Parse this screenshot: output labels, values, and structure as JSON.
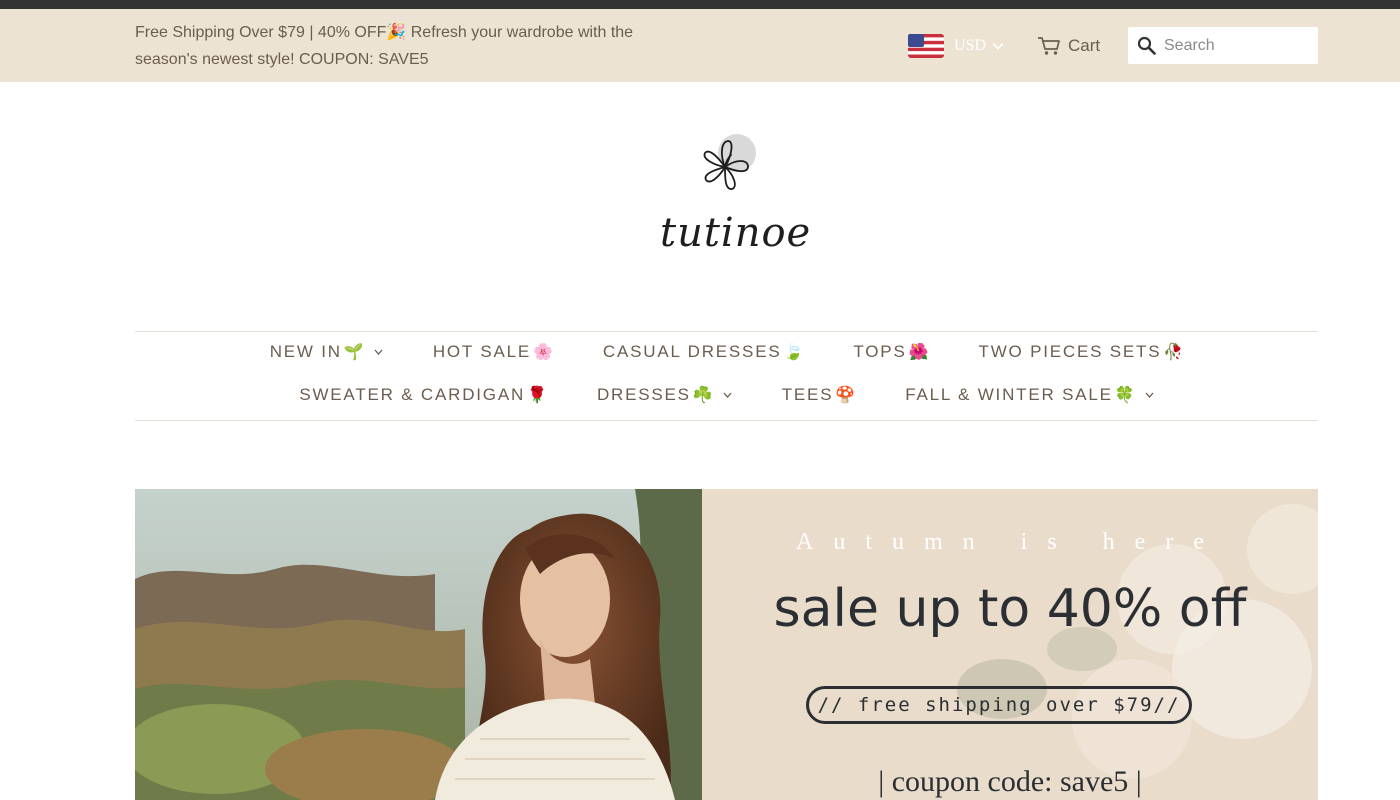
{
  "announcement": {
    "text": "Free Shipping Over $79 | 40% OFF🎉 Refresh your wardrobe with the season's newest style! COUPON: SAVE5"
  },
  "header": {
    "currency": {
      "code": "USD",
      "flag_icon": "us-flag-icon"
    },
    "cart_label": "Cart",
    "search_placeholder": "Search"
  },
  "logo": {
    "text": "tutinoe"
  },
  "nav": {
    "row1": [
      {
        "label": "NEW IN",
        "emoji": "🌱",
        "has_dropdown": true
      },
      {
        "label": "HOT SALE",
        "emoji": "🌸",
        "has_dropdown": false
      },
      {
        "label": "CASUAL DRESSES",
        "emoji": "🍃",
        "has_dropdown": false
      },
      {
        "label": "TOPS",
        "emoji": "🌺",
        "has_dropdown": false
      },
      {
        "label": "TWO PIECES SETS",
        "emoji": "🥀",
        "has_dropdown": false
      }
    ],
    "row2": [
      {
        "label": "SWEATER & CARDIGAN",
        "emoji": "🌹",
        "has_dropdown": false
      },
      {
        "label": "DRESSES",
        "emoji": "☘️",
        "has_dropdown": true
      },
      {
        "label": "TEES",
        "emoji": "🍄",
        "has_dropdown": false
      },
      {
        "label": "FALL & WINTER SALE",
        "emoji": "🍀",
        "has_dropdown": true
      }
    ]
  },
  "hero": {
    "eyebrow": "Autumn is here",
    "headline": "sale up to 40% off",
    "shipping_pill": "// free shipping over $79//",
    "coupon": "| coupon code: save5 |"
  },
  "colors": {
    "announcement_bg": "#ede3d2",
    "top_strip": "#333333",
    "text": "#6b5d4f",
    "hero_panel_bg": "#e9dccb",
    "hero_text": "#2b2f34"
  }
}
